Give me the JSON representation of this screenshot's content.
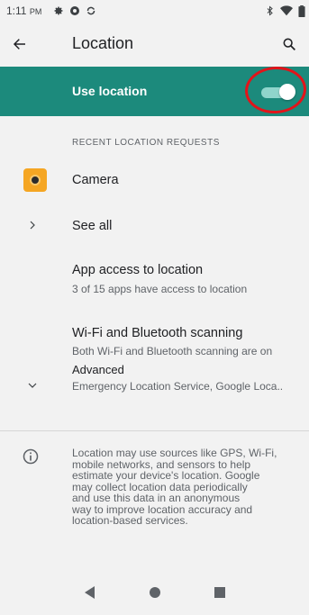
{
  "status_bar": {
    "time": "1:11",
    "ampm": "PM",
    "left_icons": [
      "settings-gear-icon",
      "circle-app-icon",
      "sync-icon"
    ],
    "right_icons": [
      "bluetooth-icon",
      "wifi-icon",
      "battery-icon"
    ]
  },
  "app_bar": {
    "title": "Location",
    "back_icon": "arrow-back-icon",
    "search_icon": "search-icon"
  },
  "master_switch": {
    "label": "Use location",
    "enabled": true,
    "accent_color": "#1c8a7c",
    "annotation_color": "#e2141a"
  },
  "recent_requests": {
    "header": "RECENT LOCATION REQUESTS",
    "items": [
      {
        "label": "Camera",
        "icon": "camera-app-icon"
      }
    ],
    "see_all_label": "See all"
  },
  "settings": {
    "app_access": {
      "title": "App access to location",
      "subtitle": "3 of 15 apps have access to location"
    },
    "scanning": {
      "title": "Wi-Fi and Bluetooth scanning",
      "subtitle": "Both Wi-Fi and Bluetooth scanning are on"
    },
    "advanced": {
      "title": "Advanced",
      "subtitle": "Emergency Location Service, Google Loca.."
    }
  },
  "footer": {
    "info_icon": "info-icon",
    "text": "Location may use sources like GPS, Wi-Fi,\nmobile networks, and sensors to help\nestimate your device's location. Google\nmay collect location data periodically\nand use this data in an anonymous\nway to improve location accuracy and\nlocation-based services."
  },
  "nav_bar": {
    "buttons": [
      "back-triangle-icon",
      "home-circle-icon",
      "recents-square-icon"
    ]
  }
}
